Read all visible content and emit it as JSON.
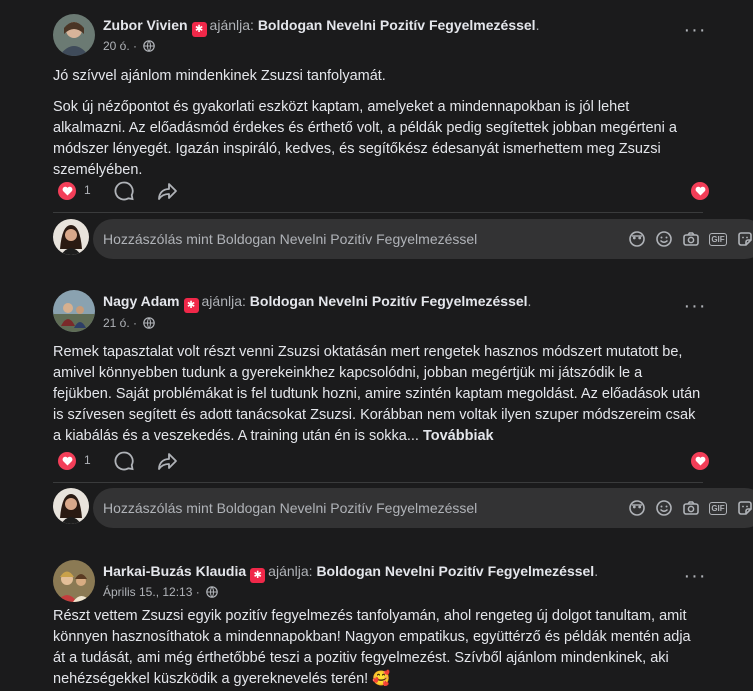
{
  "colors": {
    "accent": "#f33e58",
    "badge": "#f02849",
    "bg": "#1b1b1c"
  },
  "posts": [
    {
      "name": "Zubor Vivien",
      "recommends": "ajánlja:",
      "page": "Boldogan Nevelni Pozitív Fegyelmezéssel",
      "time": "20 ó.",
      "paragraphs": [
        "Jó szívvel ajánlom mindenkinek Zsuzsi tanfolyamát.",
        " Sok új nézőpontot és gyakorlati eszközt kaptam, amelyeket a mindennapokban is jól lehet alkalmazni. Az előadásmód érdekes és érthető volt, a példák pedig segítettek jobban megérteni a módszer lényegét. Igazán inspiráló, kedves, és segítőkész édesanyát ismerhettem meg Zsuzsi személyében."
      ],
      "reaction_count": "1",
      "comment_placeholder": "Hozzászólás mint Boldogan Nevelni Pozitív Fegyelmezéssel"
    },
    {
      "name": "Nagy Adam",
      "recommends": "ajánlja:",
      "page": "Boldogan Nevelni Pozitív Fegyelmezéssel",
      "time": "21 ó.",
      "paragraphs": [
        "Remek tapasztalat volt részt venni Zsuzsi oktatásán mert rengetek hasznos módszert mutatott be, amivel könnyebben tudunk a gyerekeinkhez kapcsolódni, jobban megértjük mi játszódik le a fejükben. Saját problémákat is fel tudtunk hozni, amire szintén kaptam megoldást. Az előadások után is szívesen segített és adott tanácsokat Zsuzsi. Korábban nem voltak ilyen szuper módszereim csak a kiabálás és a veszekedés. A training után én is sokka..."
      ],
      "see_more": "Továbbiak",
      "reaction_count": "1",
      "comment_placeholder": "Hozzászólás mint Boldogan Nevelni Pozitív Fegyelmezéssel"
    },
    {
      "name": "Harkai-Buzás Klaudia",
      "recommends": "ajánlja:",
      "page": "Boldogan Nevelni Pozitív Fegyelmezéssel",
      "time": "Április 15., 12:13",
      "paragraphs": [
        "Részt vettem Zsuzsi egyik pozitív fegyelmezés tanfolyamán, ahol rengeteg új dolgot tanultam, amit könnyen hasznosíthatok a mindennapokban! Nagyon empatikus, együttérző és példák mentén adja át a tudását, ami még érthetőbbé teszi a pozitiv fegyelmezést. Szívből ajánlom mindenkinek, aki nehézségekkel küszködik a gyereknevelés terén! 🥰"
      ]
    }
  ]
}
